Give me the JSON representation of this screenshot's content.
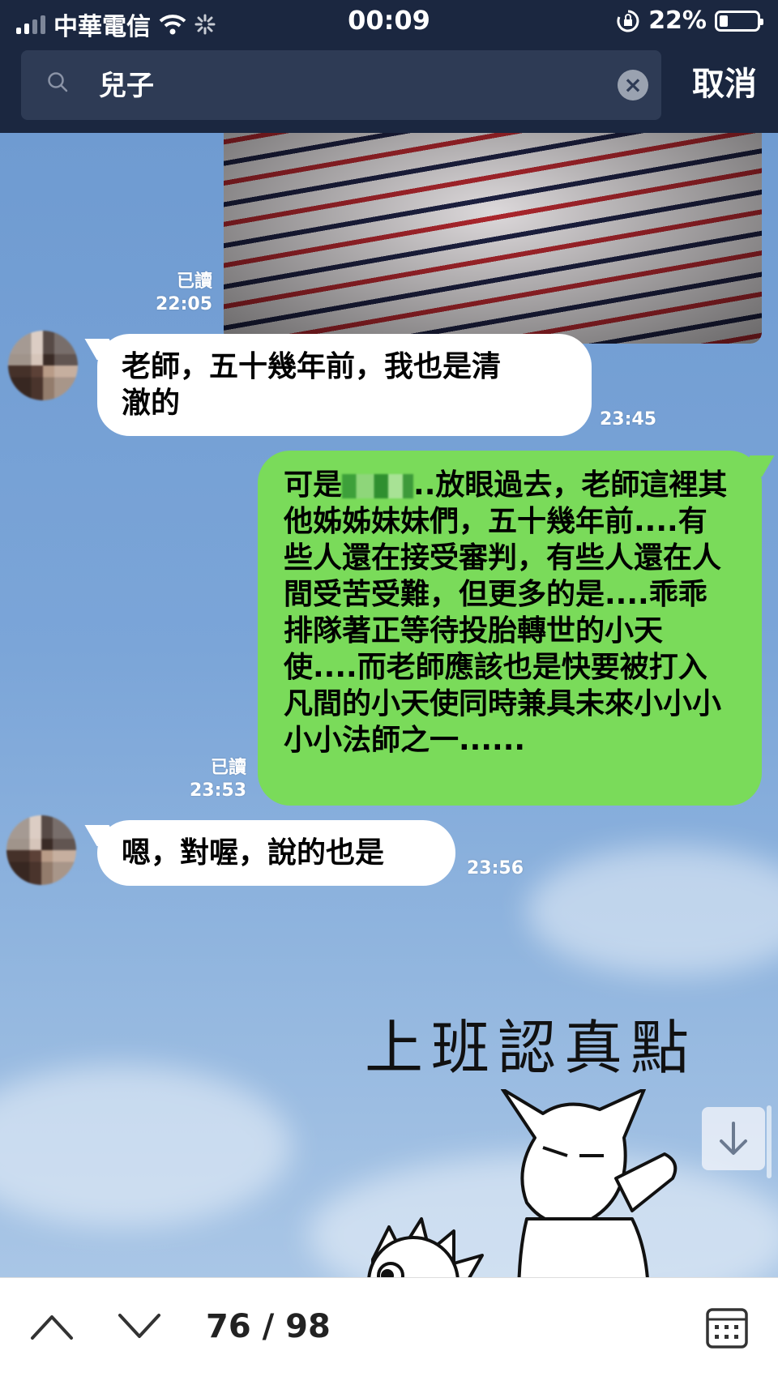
{
  "status_bar": {
    "carrier": "中華電信",
    "time": "00:09",
    "battery": "22%"
  },
  "search": {
    "query": "兒子",
    "cancel_label": "取消"
  },
  "messages": [
    {
      "id": "photo-msg",
      "direction": "out",
      "type": "image",
      "read_label": "已讀",
      "time": "22:05"
    },
    {
      "id": "m1",
      "direction": "in",
      "text_line1": "老師，五十幾年前，我也是清",
      "text_line2": "澈的",
      "time": "23:45"
    },
    {
      "id": "m2",
      "direction": "out",
      "text_prefix": "可是",
      "text_after_censor": "..放眼過去，老師這",
      "text_rest": "裡其他姊姊妹妹們，五十幾年前....有些人還在接受審判，有些人還在人間受苦受難，但更多的是....乖乖排隊著正等待投胎轉世的小天使....而老師應該也是快要被打入凡間的小天使同時兼具未來小小小小小法師之一......",
      "read_label": "已讀",
      "time": "23:53"
    },
    {
      "id": "m3",
      "direction": "in",
      "text": "嗯，對喔，說的也是",
      "time": "23:56"
    }
  ],
  "sticker": {
    "text": "上班認真點"
  },
  "bottom_bar": {
    "page_counter": "76 / 98"
  }
}
